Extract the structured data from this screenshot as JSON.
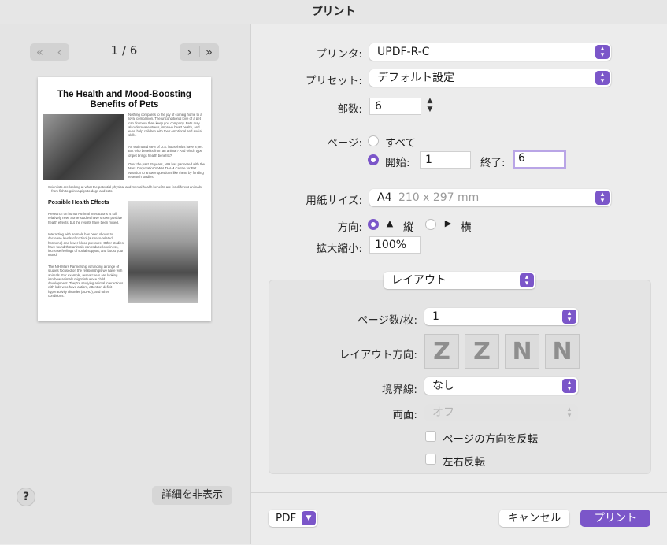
{
  "window": {
    "title": "プリント"
  },
  "preview": {
    "page_indicator": "1 / 6",
    "first_icon": "double-chevron-left-icon",
    "prev_icon": "chevron-left-icon",
    "next_icon": "chevron-right-icon",
    "last_icon": "double-chevron-right-icon",
    "doc_title": "The Health and Mood-Boosting Benefits of Pets",
    "para1": "Nothing compares to the joy of coming home to a loyal companion. The unconditional love of a pet can do more than keep you company. Pets may also decrease stress, improve heart health, and even help children with their emotional and social skills.",
    "para2": "An estimated 68% of U.S. households have a pet. But who benefits from an animal? And which type of pet brings health benefits?",
    "para3": "Over the past 15 years, NIH has partnered with the Mars Corporation's WALTHAM Centre for Pet Nutrition to answer questions like these by funding research studies.",
    "para4": "Scientists are looking at what the potential physical and mental health benefits are for different animals—from fish to guinea pigs to dogs and cats.",
    "heading2": "Possible Health Effects",
    "para5": "Research on human-animal interactions is still relatively new. Some studies have shown positive health effects, but the results have been mixed.",
    "para6": "Interacting with animals has been shown to decrease levels of cortisol (a stress-related hormone) and lower blood pressure. Other studies have found that animals can reduce loneliness, increase feelings of social support, and boost your mood.",
    "para7": "The NIH/Mars Partnership is funding a range of studies focused on the relationships we have with animals. For example, researchers are looking into how animals might influence child development. They're studying animal interactions with kids who have autism, attention deficit hyperactivity disorder (ADHD), and other conditions."
  },
  "left_footer": {
    "help_label": "?",
    "hide_details_label": "詳細を非表示"
  },
  "form": {
    "printer_label": "プリンタ:",
    "printer_value": "UPDF-R-C",
    "preset_label": "プリセット:",
    "preset_value": "デフォルト設定",
    "copies_label": "部数:",
    "copies_value": "6",
    "pages_label": "ページ:",
    "pages_all": "すべて",
    "pages_from_label": "開始:",
    "pages_from_value": "1",
    "pages_to_label": "終了:",
    "pages_to_value": "6",
    "paper_label": "用紙サイズ:",
    "paper_value": "A4",
    "paper_dims": "210 x 297 mm",
    "orientation_label": "方向:",
    "orientation_portrait": "縦",
    "orientation_landscape": "横",
    "scale_label": "拡大縮小:",
    "scale_value": "100%"
  },
  "layout": {
    "section_value": "レイアウト",
    "pages_per_sheet_label": "ページ数/枚:",
    "pages_per_sheet_value": "1",
    "direction_label": "レイアウト方向:",
    "direction_glyphs": [
      "Z",
      "Z",
      "N",
      "N"
    ],
    "border_label": "境界線:",
    "border_value": "なし",
    "duplex_label": "両面:",
    "duplex_value": "オフ",
    "reverse_orientation_label": "ページの方向を反転",
    "flip_horizontal_label": "左右反転"
  },
  "footer": {
    "pdf_label": "PDF",
    "cancel_label": "キャンセル",
    "print_label": "プリント"
  },
  "colors": {
    "accent": "#7b56c9"
  }
}
